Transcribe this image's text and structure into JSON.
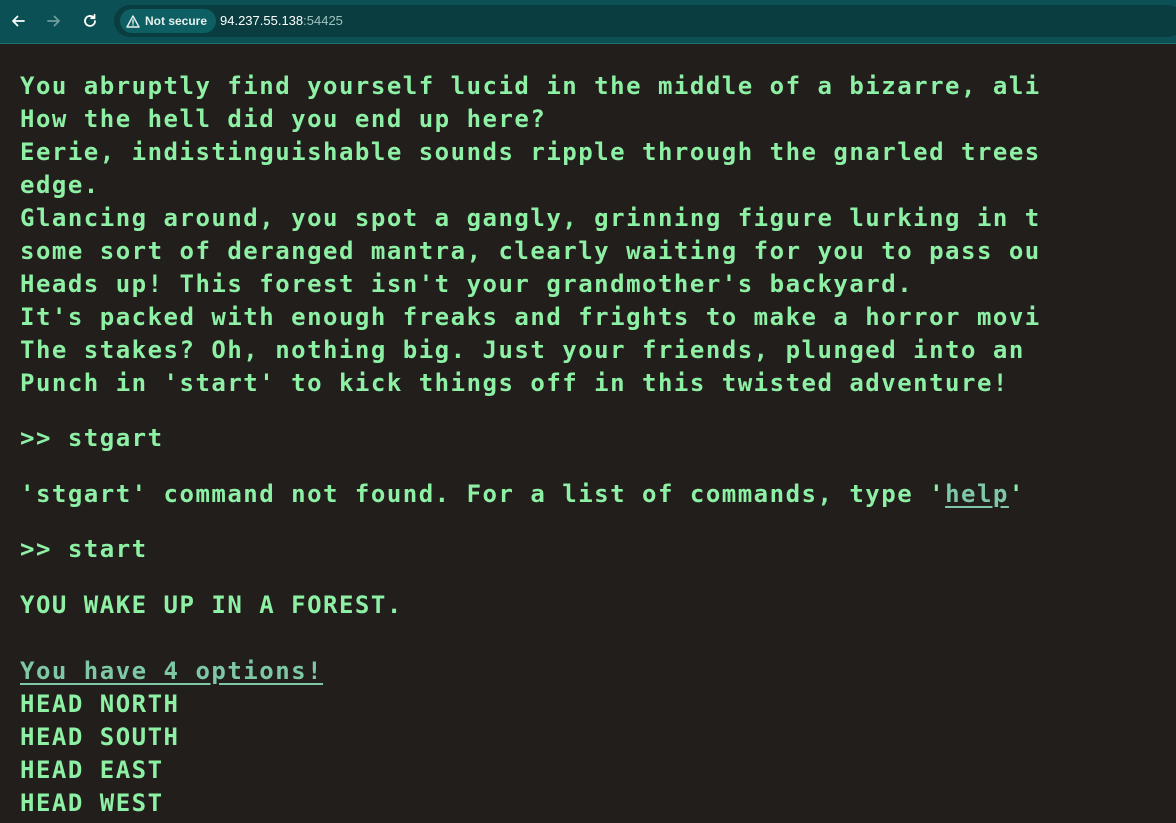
{
  "browser": {
    "security_label": "Not secure",
    "url_host": "94.237.55.138",
    "url_port": ":54425",
    "icons": [
      "back-arrow-icon",
      "forward-arrow-icon",
      "reload-icon",
      "warning-icon"
    ],
    "colors": {
      "toolbar": "#0b5054",
      "address_bar": "#0a3d40"
    }
  },
  "terminal": {
    "colors": {
      "background": "#211e1c",
      "text": "#8ef0a4",
      "link": "#7fc8a6"
    },
    "intro_lines": [
      "You abruptly find yourself lucid in the middle of a bizarre, ali",
      "How the hell did you end up here?",
      "Eerie, indistinguishable sounds ripple through the gnarled trees",
      "edge.",
      "Glancing around, you spot a gangly, grinning figure lurking in t",
      "some sort of deranged mantra, clearly waiting for you to pass ou",
      "Heads up! This forest isn't your grandmother's backyard.",
      "It's packed with enough freaks and frights to make a horror movi",
      "The stakes? Oh, nothing big. Just your friends, plunged into an",
      "Punch in 'start' to kick things off in this twisted adventure!"
    ],
    "command1": ">> stgart",
    "error_prefix": "'stgart' command not found. For a list of commands, type '",
    "error_link": "help",
    "error_suffix": "'",
    "command2": ">> start",
    "wake_text": "YOU WAKE UP IN A FOREST.",
    "options_title": "You have 4 options!",
    "options": [
      "HEAD NORTH",
      "HEAD SOUTH",
      "HEAD EAST",
      "HEAD WEST"
    ]
  }
}
